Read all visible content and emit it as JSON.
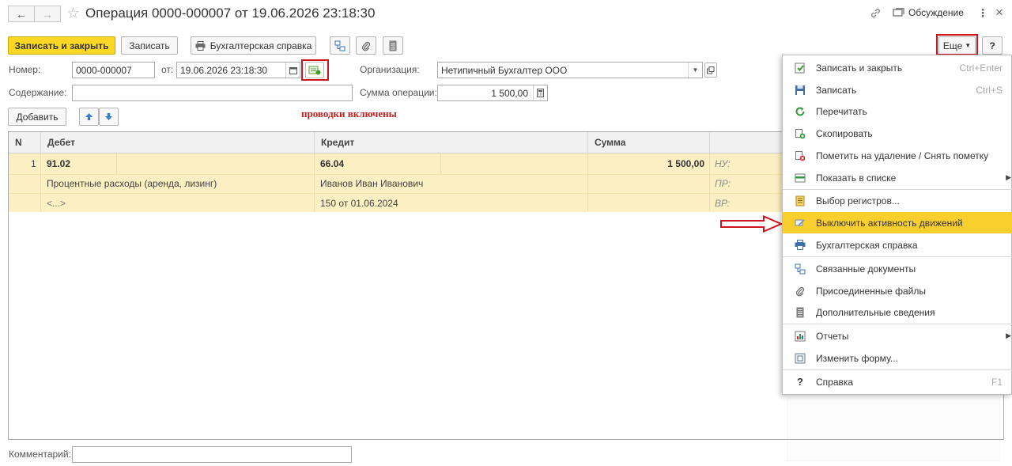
{
  "window": {
    "title": "Операция 0000-000007 от 19.06.2026 23:18:30",
    "discussion": "Обсуждение"
  },
  "toolbar": {
    "save_close": "Записать и закрыть",
    "save": "Записать",
    "accounting_report": "Бухгалтерская справка",
    "more": "Еще",
    "help": "?"
  },
  "header": {
    "number_label": "Номер:",
    "number_value": "0000-000007",
    "date_label": "от:",
    "date_value": "19.06.2026 23:18:30",
    "org_label": "Организация:",
    "org_value": "Нетипичный Бухгалтер ООО",
    "content_label": "Содержание:",
    "content_value": "",
    "sum_label": "Сумма операции:",
    "sum_value": "1 500,00",
    "add_button": "Добавить",
    "postings_note": "проводки включены"
  },
  "table": {
    "columns": [
      "N",
      "Дебет",
      "Кредит",
      "Сумма"
    ],
    "rows": [
      {
        "n": "1",
        "debit": "91.02",
        "credit": "66.04",
        "sum": "1 500,00",
        "tag1": "НУ:",
        "debit_sub1": "Процентные расходы (аренда, лизинг)",
        "credit_sub1": "Иванов Иван Иванович",
        "tag2": "ПР:",
        "debit_sub2": "<...>",
        "credit_sub2": "150 от 01.06.2024",
        "tag3": "ВР:"
      }
    ]
  },
  "footer": {
    "comment_label": "Комментарий:",
    "comment_value": ""
  },
  "menu": {
    "items": [
      {
        "label": "Записать и закрыть",
        "shortcut": "Ctrl+Enter",
        "icon": "save-close-icon"
      },
      {
        "label": "Записать",
        "shortcut": "Ctrl+S",
        "icon": "floppy-icon"
      },
      {
        "label": "Перечитать",
        "shortcut": "",
        "icon": "refresh-icon"
      },
      {
        "label": "Скопировать",
        "shortcut": "",
        "icon": "copy-icon"
      },
      {
        "label": "Пометить на удаление / Снять пометку",
        "shortcut": "",
        "icon": "delete-mark-icon"
      },
      {
        "label": "Показать в списке",
        "shortcut": "",
        "icon": "list-icon"
      },
      {
        "label": "Выбор регистров...",
        "shortcut": "",
        "icon": "registers-icon"
      },
      {
        "label": "Выключить активность движений",
        "shortcut": "",
        "icon": "toggle-movements-icon"
      },
      {
        "label": "Бухгалтерская справка",
        "shortcut": "",
        "icon": "print-icon"
      },
      {
        "label": "Связанные документы",
        "shortcut": "",
        "icon": "linked-docs-icon"
      },
      {
        "label": "Присоединенные файлы",
        "shortcut": "",
        "icon": "attachment-icon"
      },
      {
        "label": "Дополнительные сведения",
        "shortcut": "",
        "icon": "details-icon"
      },
      {
        "label": "Отчеты",
        "shortcut": "",
        "icon": "reports-icon"
      },
      {
        "label": "Изменить форму...",
        "shortcut": "",
        "icon": "form-icon"
      },
      {
        "label": "Справка",
        "shortcut": "F1",
        "icon": "help-icon"
      }
    ]
  },
  "colors": {
    "accent_yellow": "#fcd726",
    "row_highlight": "#fbefc3",
    "menu_active": "#f9cf2e",
    "annotation_red": "#d0121b"
  }
}
